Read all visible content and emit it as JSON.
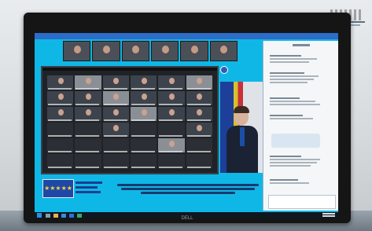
{
  "scene": {
    "description_hidden": "",
    "wall_sign_text": ""
  },
  "video_call": {
    "top_participants": 6,
    "grid_rows": 6,
    "grid_cols": 6
  },
  "monitor": {
    "brand": "DELL"
  },
  "colors": {
    "screen_background": "#0fb7e6",
    "eu_flag": "#1f47a6",
    "taskbar": "#0f1720"
  },
  "icons": {
    "eu_flag": "eu-flag-icon",
    "start": "windows-start-icon"
  }
}
